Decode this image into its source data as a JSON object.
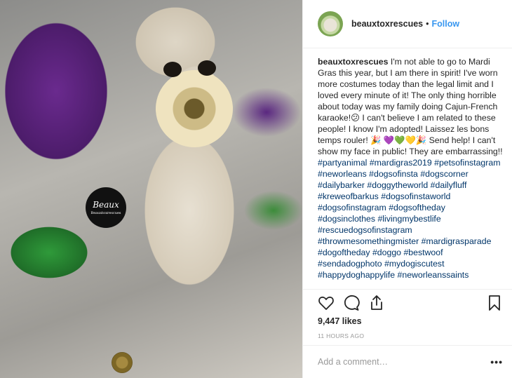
{
  "post": {
    "username": "beauxtoxrescues",
    "follow_label": "Follow",
    "separator": "•",
    "photo_logo": {
      "main": "Beaux",
      "sub": "Beauxtoxrescues"
    },
    "caption_user": "beauxtoxrescues",
    "caption_text": "I'm not able to go to Mardi Gras this year, but I am there in spirit! I've worn more costumes today than the legal limit and I loved every minute of it! The only thing horrible about today was my family doing Cajun-French karaoke!",
    "caption_text_2": "I can't believe I am related to these people! I know I'm adopted! Laissez les bons temps rouler!",
    "caption_text_3": "Send help! I can't show my face in public! They are embarrassing!!",
    "emoji_1": "😕",
    "emoji_2": "🎉",
    "emoji_3": "💜💚💛",
    "emoji_4": "🎉",
    "hashtags": [
      "#partyanimal",
      "#mardigras2019",
      "#petsofinstagram",
      "#neworleans",
      "#dogsofinsta",
      "#dogscorner",
      "#dailybarker",
      "#doggytheworld",
      "#dailyfluff",
      "#kreweofbarkus",
      "#dogsofinstaworld",
      "#dogsofinstagram",
      "#dogsoftheday",
      "#dogsinclothes",
      "#livingmybestlife",
      "#rescuedogsofinstagram",
      "#throwmesomethingmister",
      "#mardigrasparade",
      "#dogoftheday",
      "#doggo",
      "#bestwoof",
      "#sendadogphoto",
      "#mydogiscutest",
      "#happydoghappylife",
      "#neworleanssaints"
    ],
    "likes": "9,447 likes",
    "timestamp": "11 HOURS AGO",
    "comment_placeholder": "Add a comment…",
    "more_label": "•••"
  },
  "icons": {
    "like": "heart-icon",
    "comment": "comment-bubble-icon",
    "share": "share-icon",
    "save": "bookmark-icon"
  }
}
